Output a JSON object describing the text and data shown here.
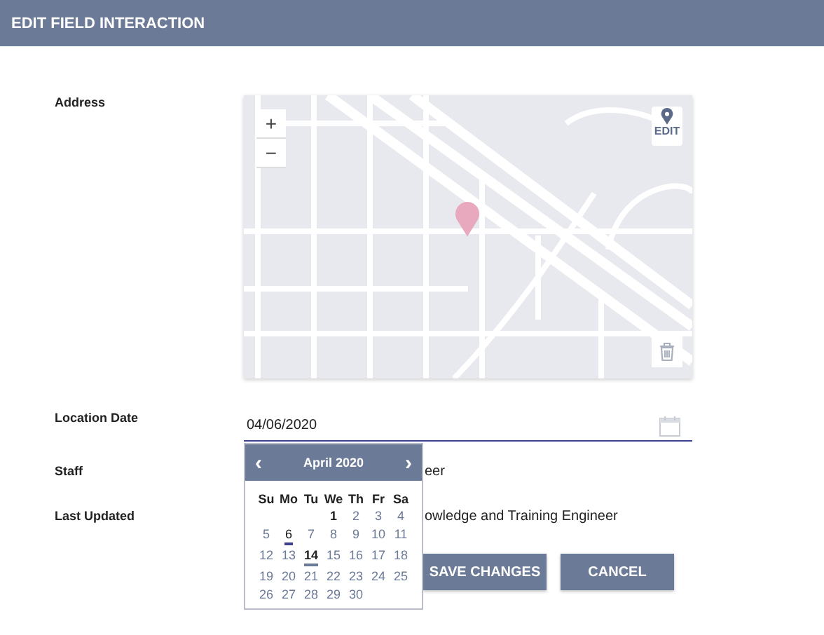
{
  "header": {
    "title": "EDIT FIELD INTERACTION"
  },
  "address": {
    "label": "Address",
    "map": {
      "zoom_in": "+",
      "zoom_out": "−",
      "edit_label": "EDIT"
    }
  },
  "location_date": {
    "label": "Location Date",
    "value": "04/06/2020"
  },
  "calendar": {
    "prev": "‹",
    "next": "›",
    "title": "April 2020",
    "weekdays": [
      "Su",
      "Mo",
      "Tu",
      "We",
      "Th",
      "Fr",
      "Sa"
    ],
    "weeks": [
      [
        {
          "label": "1",
          "selected": false,
          "today": false,
          "hovered": true
        },
        {
          "label": "2",
          "selected": false,
          "today": false,
          "hovered": false
        },
        {
          "label": "3",
          "selected": false,
          "today": false,
          "hovered": false
        },
        {
          "label": "4",
          "selected": false,
          "today": false,
          "hovered": false
        }
      ],
      [
        {
          "label": "5",
          "selected": false,
          "today": false,
          "hovered": false
        },
        {
          "label": "6",
          "selected": true,
          "today": false,
          "hovered": false
        },
        {
          "label": "7",
          "selected": false,
          "today": false,
          "hovered": false
        },
        {
          "label": "8",
          "selected": false,
          "today": false,
          "hovered": false
        },
        {
          "label": "9",
          "selected": false,
          "today": false,
          "hovered": false
        },
        {
          "label": "10",
          "selected": false,
          "today": false,
          "hovered": false
        },
        {
          "label": "11",
          "selected": false,
          "today": false,
          "hovered": false
        }
      ],
      [
        {
          "label": "12",
          "selected": false,
          "today": false,
          "hovered": false
        },
        {
          "label": "13",
          "selected": false,
          "today": false,
          "hovered": false
        },
        {
          "label": "14",
          "selected": false,
          "today": true,
          "hovered": false
        },
        {
          "label": "15",
          "selected": false,
          "today": false,
          "hovered": false
        },
        {
          "label": "16",
          "selected": false,
          "today": false,
          "hovered": false
        },
        {
          "label": "17",
          "selected": false,
          "today": false,
          "hovered": false
        },
        {
          "label": "18",
          "selected": false,
          "today": false,
          "hovered": false
        }
      ],
      [
        {
          "label": "19",
          "selected": false,
          "today": false,
          "hovered": false
        },
        {
          "label": "20",
          "selected": false,
          "today": false,
          "hovered": false
        },
        {
          "label": "21",
          "selected": false,
          "today": false,
          "hovered": false
        },
        {
          "label": "22",
          "selected": false,
          "today": false,
          "hovered": false
        },
        {
          "label": "23",
          "selected": false,
          "today": false,
          "hovered": false
        },
        {
          "label": "24",
          "selected": false,
          "today": false,
          "hovered": false
        },
        {
          "label": "25",
          "selected": false,
          "today": false,
          "hovered": false
        }
      ],
      [
        {
          "label": "26",
          "selected": false,
          "today": false,
          "hovered": false
        },
        {
          "label": "27",
          "selected": false,
          "today": false,
          "hovered": false
        },
        {
          "label": "28",
          "selected": false,
          "today": false,
          "hovered": false
        },
        {
          "label": "29",
          "selected": false,
          "today": false,
          "hovered": false
        },
        {
          "label": "30",
          "selected": false,
          "today": false,
          "hovered": false
        }
      ]
    ]
  },
  "staff": {
    "label": "Staff",
    "value": "eer"
  },
  "last_updated": {
    "label": "Last Updated",
    "value": "owledge and Training Engineer"
  },
  "buttons": [
    {
      "label": "SAVE CHANGES"
    },
    {
      "label": "CANCEL"
    }
  ]
}
